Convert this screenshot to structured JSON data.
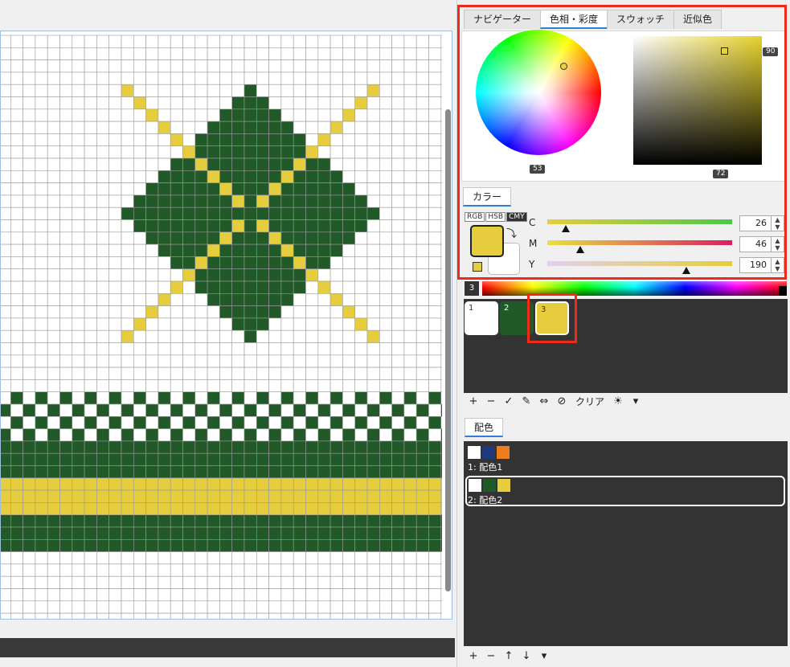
{
  "top_tabs": [
    {
      "label": "ナビゲーター",
      "active": false
    },
    {
      "label": "色相・彩度",
      "active": true
    },
    {
      "label": "スウォッチ",
      "active": false
    },
    {
      "label": "近似色",
      "active": false
    }
  ],
  "picker": {
    "hue_value": "53",
    "brightness_value": "90",
    "saturation_value": "72"
  },
  "color_tab": {
    "label": "カラー"
  },
  "modes": [
    "RGB",
    "HSB",
    "CMY"
  ],
  "active_mode": "CMY",
  "current_color": "#e6cd3e",
  "sliders": [
    {
      "label": "C",
      "value": "26",
      "fraction": 0.1
    },
    {
      "label": "M",
      "value": "46",
      "fraction": 0.18
    },
    {
      "label": "Y",
      "value": "190",
      "fraction": 0.75
    }
  ],
  "rainbow_index": "3",
  "palette": [
    {
      "number": "1",
      "color": "#ffffff"
    },
    {
      "number": "2",
      "color": "#215a28"
    },
    {
      "number": "3",
      "color": "#e6cd3e"
    }
  ],
  "palette_toolbar": {
    "add": "+",
    "remove": "−",
    "apply": "✓",
    "edit": "✎",
    "swap": "⇔",
    "none": "⊘",
    "clear_label": "クリア",
    "sun": "☀",
    "menu": "▾"
  },
  "scheme_tab": {
    "label": "配色"
  },
  "schemes": [
    {
      "label": "1: 配色1",
      "colors": [
        "#ffffff",
        "#1f3a7a",
        "#f07d1c"
      ]
    },
    {
      "label": "2: 配色2",
      "colors": [
        "#ffffff",
        "#215a28",
        "#e6cd3e"
      ],
      "selected": true
    }
  ],
  "scheme_toolbar": {
    "add": "+",
    "remove": "−",
    "up": "↑",
    "down": "↓",
    "menu": "▾"
  },
  "grid_colors": {
    "white": "#ffffff",
    "green": "#215a28",
    "yellow": "#e6cd3e",
    "line": "#9a9a9a"
  }
}
